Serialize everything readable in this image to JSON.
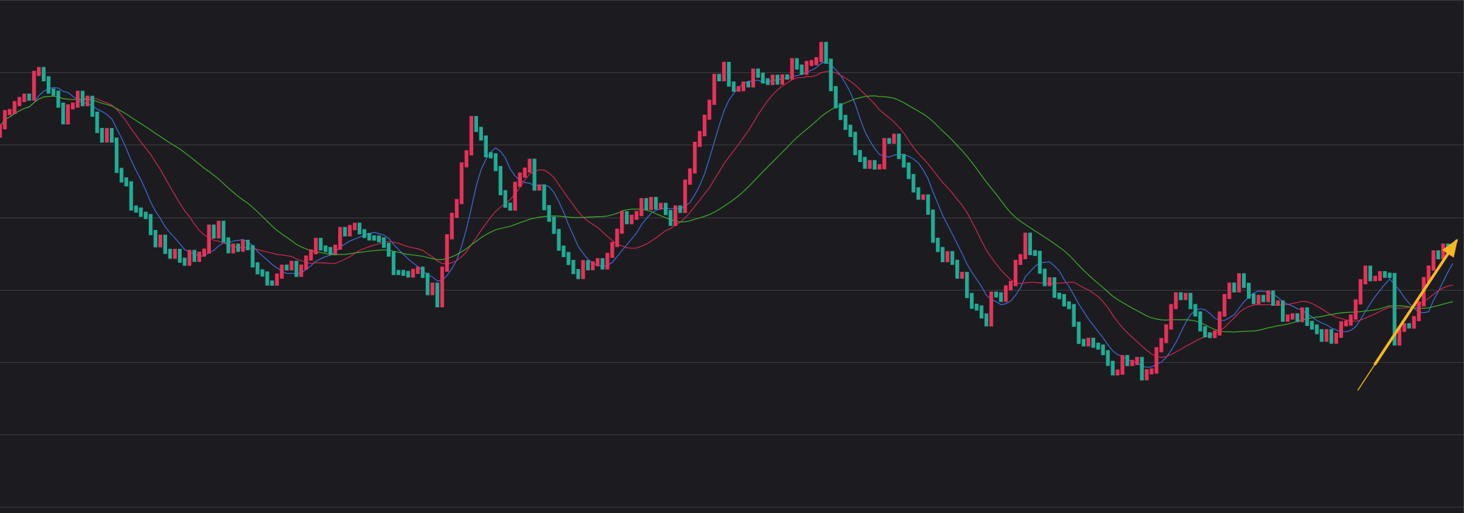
{
  "colors": {
    "background": "#1c1c20",
    "grid": "#3c3c42",
    "up": "#e6325a",
    "down": "#22ab94",
    "ma_fast": "#3f6fe0",
    "ma_mid": "#d2284e",
    "ma_slow": "#3fae2e",
    "arrow": "#f5b820"
  },
  "chart_data": {
    "type": "candlestick",
    "grid": true,
    "legend": "none",
    "y_range": [
      0,
      100
    ],
    "x_range": [
      0,
      300
    ],
    "path_keys": [
      [
        0,
        80
      ],
      [
        3,
        86
      ],
      [
        8,
        92
      ],
      [
        13,
        84
      ],
      [
        18,
        87
      ],
      [
        22,
        76
      ],
      [
        29,
        58
      ],
      [
        37,
        48
      ],
      [
        45,
        55
      ],
      [
        57,
        44
      ],
      [
        72,
        56
      ],
      [
        90,
        41
      ],
      [
        97,
        81
      ],
      [
        105,
        62
      ],
      [
        109,
        71
      ],
      [
        114,
        56
      ],
      [
        118,
        45
      ],
      [
        125,
        51
      ],
      [
        131,
        63
      ],
      [
        140,
        60
      ],
      [
        147,
        92
      ],
      [
        160,
        91
      ],
      [
        169,
        96
      ],
      [
        177,
        69
      ],
      [
        184,
        76
      ],
      [
        194,
        50
      ],
      [
        203,
        35
      ],
      [
        211,
        52
      ],
      [
        217,
        41
      ],
      [
        224,
        29
      ],
      [
        232,
        23
      ],
      [
        237,
        24
      ],
      [
        243,
        43
      ],
      [
        248,
        30
      ],
      [
        255,
        43
      ],
      [
        268,
        34
      ],
      [
        275,
        29
      ],
      [
        281,
        45
      ],
      [
        286,
        45
      ],
      [
        287,
        28
      ],
      [
        295,
        47
      ],
      [
        299,
        54
      ]
    ],
    "moving_averages": [
      {
        "role": "fast",
        "window": 8
      },
      {
        "role": "mid",
        "window": 18
      },
      {
        "role": "slow",
        "window": 38
      }
    ],
    "trend_arrow": {
      "from": [
        283,
        24
      ],
      "to": [
        300,
        53
      ]
    }
  }
}
